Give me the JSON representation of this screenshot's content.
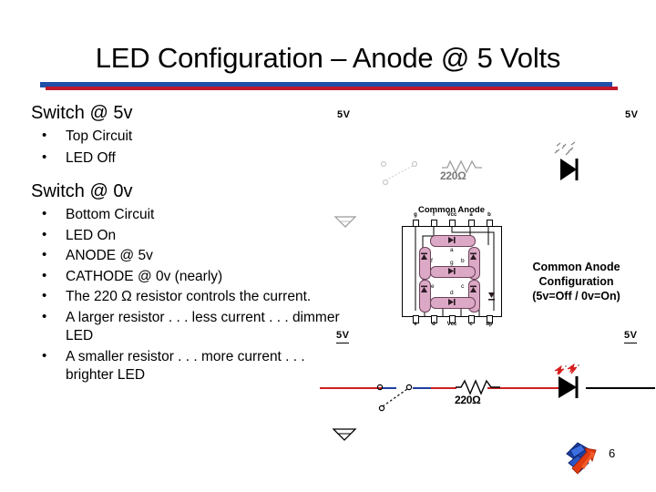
{
  "slide": {
    "title": "LED Configuration – Anode @ 5 Volts",
    "page_number": "6",
    "accent_blue": "#1F4FA8",
    "accent_red": "#C0182B"
  },
  "content": {
    "heading_1": "Switch @ 5v",
    "bullets_1": [
      "Top Circuit",
      "LED Off"
    ],
    "heading_2": "Switch @ 0v",
    "bullets_2": [
      "Bottom Circuit",
      "LED On",
      "ANODE @ 5v",
      "CATHODE @ 0v (nearly)",
      "The 220 Ω resistor controls the current.",
      "A larger resistor . . . less current . . . dimmer LED",
      "A smaller resistor . . . more current . . . brighter LED"
    ]
  },
  "diagram": {
    "top_circuit": {
      "supply_left_label": "5V",
      "supply_right_label": "5V",
      "resistor_label": "220Ω",
      "led_state": "off"
    },
    "bottom_circuit": {
      "supply_left_label": "5V",
      "supply_right_label": "5V",
      "resistor_label": "220Ω",
      "led_state": "on"
    },
    "seven_segment": {
      "title": "Common Anode",
      "pins_top": [
        "g",
        "f",
        "Vcc",
        "a",
        "b"
      ],
      "pins_bottom": [
        "e",
        "d",
        "Vcc",
        "c",
        "dp"
      ],
      "segment_letters": [
        "a",
        "b",
        "c",
        "d",
        "e",
        "f",
        "g"
      ],
      "segment_color": "#DBA9C6"
    },
    "caption": {
      "line1": "Common Anode",
      "line2": "Configuration",
      "line3": "(5v=Off / 0v=On)"
    }
  }
}
